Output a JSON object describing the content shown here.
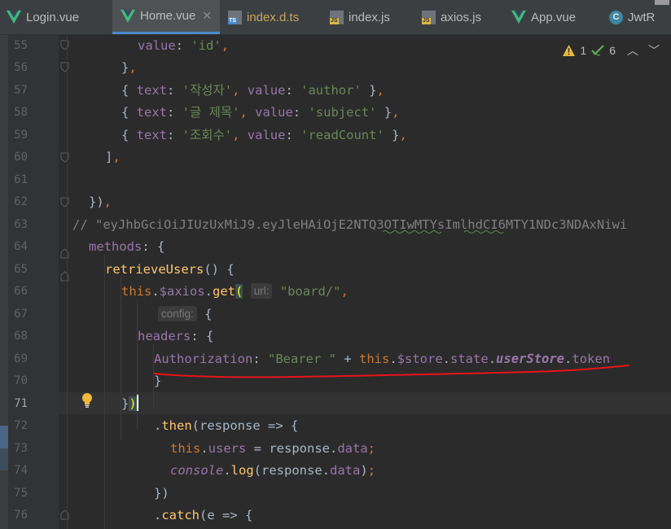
{
  "tabs": [
    {
      "label": "Login.vue",
      "icon": "vue-icon",
      "active": false
    },
    {
      "label": "Home.vue",
      "icon": "vue-icon",
      "active": true
    },
    {
      "label": "index.d.ts",
      "icon": "ts-file-icon",
      "active": false
    },
    {
      "label": "index.js",
      "icon": "js-file-icon",
      "active": false
    },
    {
      "label": "axios.js",
      "icon": "js-file-icon",
      "active": false
    },
    {
      "label": "App.vue",
      "icon": "vue-icon",
      "active": false
    },
    {
      "label": "JwtR",
      "icon": "class-icon",
      "active": false
    }
  ],
  "inspections": {
    "warnings": "1",
    "typos": "6"
  },
  "line_numbers": [
    "55",
    "56",
    "57",
    "58",
    "59",
    "60",
    "61",
    "62",
    "63",
    "64",
    "65",
    "66",
    "67",
    "68",
    "69",
    "70",
    "71",
    "72",
    "73",
    "74",
    "75",
    "76"
  ],
  "current_line": "71",
  "code": {
    "l55": {
      "value_key": "value",
      "value_str": "'id'"
    },
    "l57": {
      "text_key": "text",
      "text_str": "'작성자'",
      "value_key": "value",
      "value_str": "'author'"
    },
    "l58": {
      "text_key": "text",
      "text_str": "'글 제목'",
      "value_key": "value",
      "value_str": "'subject'"
    },
    "l59": {
      "text_key": "text",
      "text_str": "'조회수'",
      "value_key": "value",
      "value_str": "'readCount'"
    },
    "l63": {
      "comment": "// \"eyJhbGciOiJIUzUxMiJ9.eyJleHAiOjE2NTQ3OTIwMTYsImlhdCI6MTY1NDc3NDAxNiwi"
    },
    "l64": {
      "key": "methods"
    },
    "l65": {
      "fn": "retrieveUsers"
    },
    "l66": {
      "this": "this",
      "axios": "$axios",
      "get": "get",
      "hint_url": "url:",
      "url": "\"board/\""
    },
    "l67": {
      "hint_config": "config:"
    },
    "l68": {
      "key": "headers"
    },
    "l69": {
      "auth_key": "Authorization",
      "bearer": "\"Bearer \"",
      "this": "this",
      "store": "$store",
      "state": "state",
      "userStore": "userStore",
      "token": "token"
    },
    "l72": {
      "then": "then",
      "param": "response"
    },
    "l73": {
      "this": "this",
      "users": "users",
      "response": "response",
      "data": "data"
    },
    "l74": {
      "console": "console",
      "log": "log",
      "response": "response",
      "data": "data"
    },
    "l76": {
      "catch": "catch",
      "param": "e"
    }
  },
  "colors": {
    "background": "#2b2b2b",
    "string": "#6a8759",
    "property": "#9876aa",
    "keyword": "#cc7832",
    "function": "#ffc66d",
    "annotation_red": "#e8141b"
  }
}
